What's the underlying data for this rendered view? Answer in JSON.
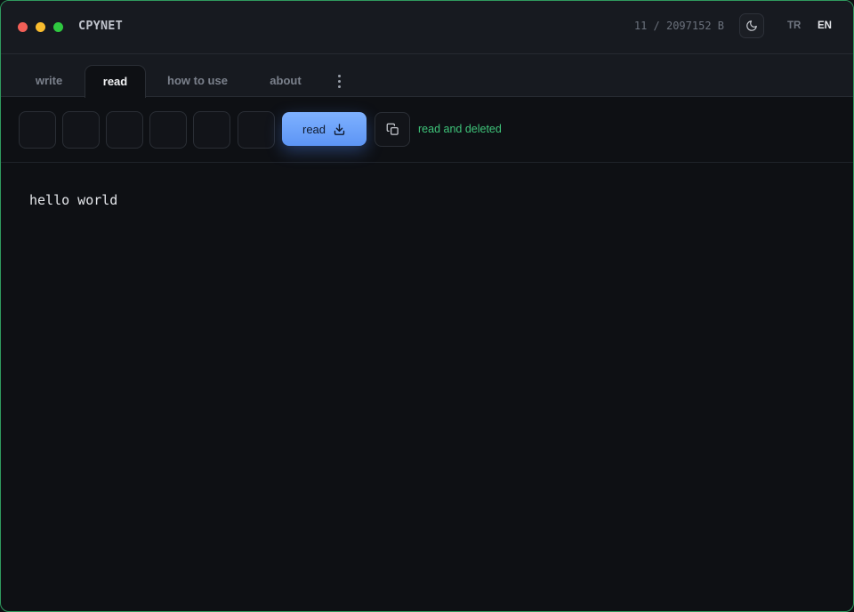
{
  "app": {
    "title": "CPYNET"
  },
  "header": {
    "counter": "11 / 2097152 B",
    "theme_icon": "moon-icon",
    "languages": [
      "TR",
      "EN"
    ],
    "active_language": "EN"
  },
  "tabs": [
    {
      "label": "write",
      "active": false
    },
    {
      "label": "read",
      "active": true
    },
    {
      "label": "how to use",
      "active": false
    },
    {
      "label": "about",
      "active": false
    }
  ],
  "read_panel": {
    "code_boxes": [
      "",
      "",
      "",
      "",
      "",
      ""
    ],
    "read_button": {
      "label": "read",
      "icon": "download-icon"
    },
    "copy_icon": "copy-icon",
    "status": "read and deleted"
  },
  "content": {
    "text": "hello world"
  },
  "colors": {
    "accent": "#6ea3fb",
    "status": "#3fc57a",
    "window_border": "#2f9a5e",
    "background": "#0e1014"
  }
}
